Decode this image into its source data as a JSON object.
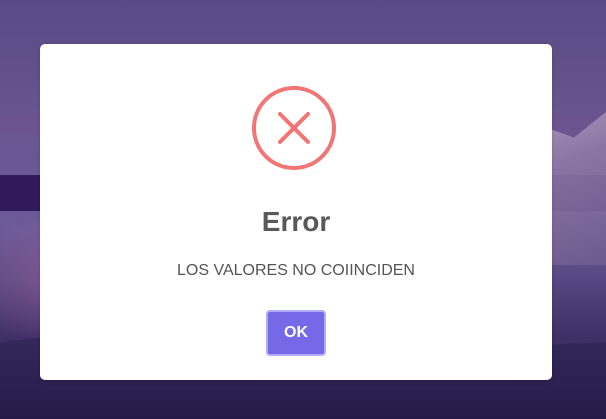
{
  "dialog": {
    "title": "Error",
    "message": "LOS VALORES NO COIINCIDEN",
    "ok_label": "OK",
    "icon": "error-x-icon"
  },
  "colors": {
    "icon_stroke": "#f27474",
    "button_bg": "#7669e8",
    "button_border": "#b3abf5",
    "title_text": "#595959",
    "message_text": "#545454"
  }
}
